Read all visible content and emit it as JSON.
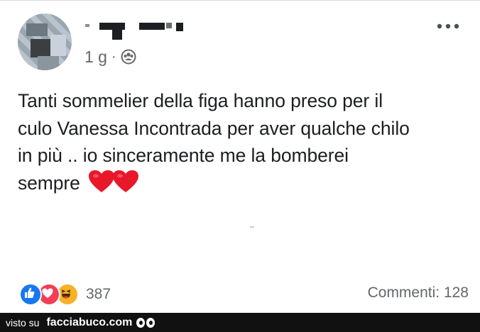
{
  "post": {
    "timestamp": "1 g",
    "separator": "·",
    "audience_icon": "friends-group-icon",
    "text_line1": "Tanti sommelier della figa hanno preso per il",
    "text_line2": "culo Vanessa Incontrada per aver qualche chilo",
    "text_line3": "in più .. io sinceramente me la bomberei",
    "text_line4": "sempre",
    "emojis": [
      "red-heart-icon",
      "red-heart-icon"
    ],
    "more_icon": "more-options-icon"
  },
  "reactions": {
    "types": [
      "like-icon",
      "love-icon",
      "haha-icon"
    ],
    "count": "387"
  },
  "comments": {
    "label": "Commenti: 128"
  },
  "watermark": {
    "prefix": "visto su",
    "site": "facciabuco.com"
  },
  "colors": {
    "like_blue": "#1877f2",
    "love_red": "#f33e58",
    "haha_yellow": "#f7b125",
    "text_primary": "#1c1e21",
    "text_secondary": "#65676b"
  }
}
